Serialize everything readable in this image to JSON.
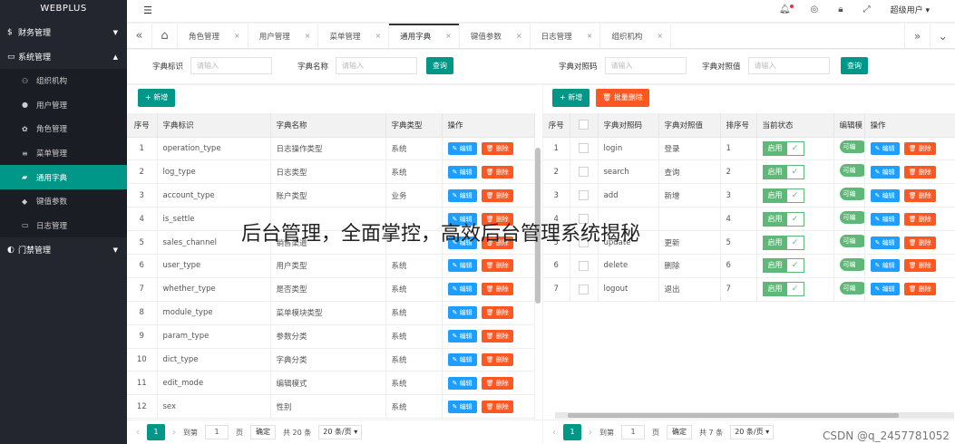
{
  "app": {
    "logo": "WEBPLUS"
  },
  "sidebar": {
    "groups": [
      {
        "icon": "$",
        "label": "财务管理",
        "expanded": false
      },
      {
        "icon": "▭",
        "label": "系统管理",
        "expanded": true
      },
      {
        "icon": "◐",
        "label": "门禁管理",
        "expanded": false
      }
    ],
    "items": [
      {
        "icon": "⚇",
        "label": "组织机构",
        "active": false
      },
      {
        "icon": "●",
        "label": "用户管理",
        "active": false
      },
      {
        "icon": "✿",
        "label": "角色管理",
        "active": false
      },
      {
        "icon": "≡",
        "label": "菜单管理",
        "active": false
      },
      {
        "icon": "▰",
        "label": "通用字典",
        "active": true
      },
      {
        "icon": "◆",
        "label": "键值参数",
        "active": false
      },
      {
        "icon": "▭",
        "label": "日志管理",
        "active": false
      }
    ]
  },
  "topbar": {
    "user": "超级用户 ▾"
  },
  "tabs": [
    {
      "label": "角色管理",
      "active": false
    },
    {
      "label": "用户管理",
      "active": false
    },
    {
      "label": "菜单管理",
      "active": false
    },
    {
      "label": "通用字典",
      "active": true
    },
    {
      "label": "键值参数",
      "active": false
    },
    {
      "label": "日志管理",
      "active": false
    },
    {
      "label": "组织机构",
      "active": false
    }
  ],
  "search": {
    "field1_label": "字典标识",
    "field1_placeholder": "请输入",
    "field2_label": "字典名称",
    "field2_placeholder": "请输入",
    "query1": "查询",
    "field3_label": "字典对照码",
    "field3_placeholder": "请输入",
    "field4_label": "字典对照值",
    "field4_placeholder": "请输入",
    "query2": "查询"
  },
  "left": {
    "add_label": "+ 新增",
    "columns": [
      "序号",
      "字典标识",
      "字典名称",
      "字典类型",
      "操作"
    ],
    "edit_label": "✎ 编辑",
    "delete_label": "🗑 删除",
    "rows": [
      [
        "1",
        "operation_type",
        "日志操作类型",
        "系统"
      ],
      [
        "2",
        "log_type",
        "日志类型",
        "系统"
      ],
      [
        "3",
        "account_type",
        "账户类型",
        "业务"
      ],
      [
        "4",
        "is_settle",
        "",
        ""
      ],
      [
        "5",
        "sales_channel",
        "销售渠道",
        ""
      ],
      [
        "6",
        "user_type",
        "用户类型",
        "系统"
      ],
      [
        "7",
        "whether_type",
        "是否类型",
        "系统"
      ],
      [
        "8",
        "module_type",
        "菜单模块类型",
        "系统"
      ],
      [
        "9",
        "param_type",
        "参数分类",
        "系统"
      ],
      [
        "10",
        "dict_type",
        "字典分类",
        "系统"
      ],
      [
        "11",
        "edit_mode",
        "编辑模式",
        "系统"
      ],
      [
        "12",
        "sex",
        "性别",
        "系统"
      ]
    ],
    "pager": {
      "prev": "‹",
      "current": "1",
      "next": "›",
      "goto": "到第",
      "page_input": "1",
      "page_unit": "页",
      "confirm": "确定",
      "total": "共 20 条",
      "per_page": "20 条/页 ▾"
    }
  },
  "right": {
    "add_label": "+ 新增",
    "batch_delete_label": "🗑 批量删除",
    "columns": [
      "序号",
      "",
      "字典对照码",
      "字典对照值",
      "排序号",
      "当前状态",
      "编辑模",
      "操作"
    ],
    "status_on": "启用",
    "toggle_label": "可编",
    "edit_label": "✎ 编辑",
    "delete_label": "🗑 删除",
    "rows": [
      [
        "1",
        "login",
        "登录",
        "1"
      ],
      [
        "2",
        "search",
        "查询",
        "2"
      ],
      [
        "3",
        "add",
        "新增",
        "3"
      ],
      [
        "4",
        "",
        "",
        "4"
      ],
      [
        "5",
        "update",
        "更新",
        "5"
      ],
      [
        "6",
        "delete",
        "删除",
        "6"
      ],
      [
        "7",
        "logout",
        "退出",
        "7"
      ]
    ],
    "pager": {
      "prev": "‹",
      "current": "1",
      "next": "›",
      "goto": "到第",
      "page_input": "1",
      "page_unit": "页",
      "confirm": "确定",
      "total": "共 7 条",
      "per_page": "20 条/页 ▾"
    }
  },
  "overlay_text": "后台管理，全面掌控，高效后台管理系统揭秘",
  "watermark": "CSDN @q_2457781052"
}
